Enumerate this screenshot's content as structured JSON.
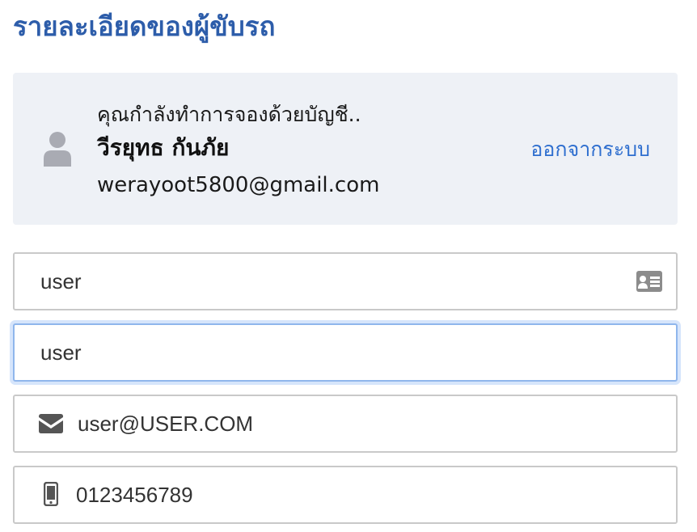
{
  "page": {
    "title": "รายละเอียดของผู้ขับรถ"
  },
  "account": {
    "booking_as": "คุณกำลังทำการจองด้วยบัญชี..",
    "name": "วีรยุทธ กันภัย",
    "email": "werayoot5800@gmail.com",
    "logout_label": "ออกจากระบบ"
  },
  "form": {
    "first_name": "user",
    "last_name": "user",
    "email": "user@USER.COM",
    "phone": "0123456789"
  },
  "icons": {
    "avatar": "user-icon",
    "id_card": "id-card-icon",
    "envelope": "envelope-icon",
    "mobile": "mobile-phone-icon"
  },
  "colors": {
    "title": "#2d5daa",
    "link": "#2f6fcf",
    "card_bg": "#eef1f6",
    "focus_border": "#8fb6ec"
  }
}
